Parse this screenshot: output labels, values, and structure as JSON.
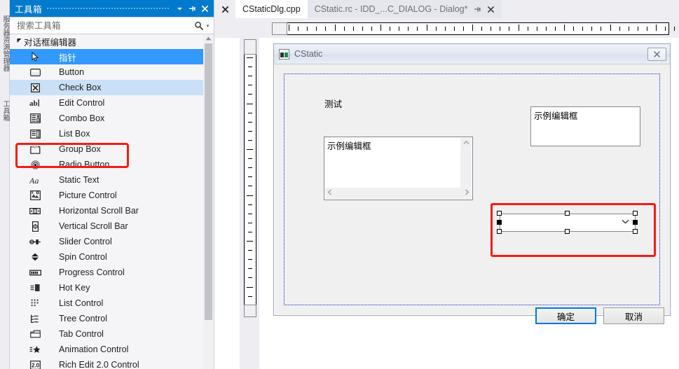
{
  "vertical_tabs": [
    {
      "label": "服务器资源管理器"
    },
    {
      "label": "工具箱"
    }
  ],
  "toolbox": {
    "title": "工具箱",
    "window_buttons": [
      {
        "name": "dropdown",
        "glyph": "▼"
      },
      {
        "name": "auto-hide-pin",
        "glyph": "pin"
      },
      {
        "name": "close",
        "glyph": "✕"
      }
    ],
    "search": {
      "placeholder": "搜索工具箱",
      "icon": "search-icon",
      "caret": "▾"
    },
    "category": {
      "label": "对话框编辑器",
      "expanded": true,
      "arrow": "◢"
    },
    "items": [
      {
        "label": "指针",
        "icon": "pointer-icon",
        "state": "selected"
      },
      {
        "label": "Button",
        "icon": "button-icon",
        "state": "normal"
      },
      {
        "label": "Check Box",
        "icon": "checkbox-icon",
        "state": "hover"
      },
      {
        "label": "Edit Control",
        "icon": "edit-control-icon",
        "state": "normal"
      },
      {
        "label": "Combo Box",
        "icon": "combobox-icon",
        "state": "highlighted"
      },
      {
        "label": "List Box",
        "icon": "listbox-icon",
        "state": "normal"
      },
      {
        "label": "Group Box",
        "icon": "groupbox-icon",
        "state": "normal"
      },
      {
        "label": "Radio Button",
        "icon": "radio-icon",
        "state": "normal"
      },
      {
        "label": "Static Text",
        "icon": "static-text-icon",
        "state": "normal"
      },
      {
        "label": "Picture Control",
        "icon": "picture-icon",
        "state": "normal"
      },
      {
        "label": "Horizontal Scroll Bar",
        "icon": "hscroll-icon",
        "state": "normal"
      },
      {
        "label": "Vertical Scroll Bar",
        "icon": "vscroll-icon",
        "state": "normal"
      },
      {
        "label": "Slider Control",
        "icon": "slider-icon",
        "state": "normal"
      },
      {
        "label": "Spin Control",
        "icon": "spin-icon",
        "state": "normal"
      },
      {
        "label": "Progress Control",
        "icon": "progress-icon",
        "state": "normal"
      },
      {
        "label": "Hot Key",
        "icon": "hotkey-icon",
        "state": "normal"
      },
      {
        "label": "List Control",
        "icon": "list-control-icon",
        "state": "normal"
      },
      {
        "label": "Tree Control",
        "icon": "tree-icon",
        "state": "normal"
      },
      {
        "label": "Tab Control",
        "icon": "tab-icon",
        "state": "normal"
      },
      {
        "label": "Animation Control",
        "icon": "animation-icon",
        "state": "normal"
      },
      {
        "label": "Rich Edit 2.0 Control",
        "icon": "richedit-icon",
        "state": "normal"
      }
    ]
  },
  "editor": {
    "close_all_glyph": "✕",
    "tabs": [
      {
        "label": "CStaticDlg.cpp",
        "active": false,
        "pinned": false,
        "closable": false
      },
      {
        "label": "CStatic.rc - IDD_...C_DIALOG - Dialog*",
        "active": true,
        "pinned": true,
        "closable": true
      }
    ]
  },
  "dialog": {
    "title": "CStatic",
    "close_glyph": "✕",
    "label": "测试",
    "edit_left": "示例编辑框",
    "edit_right": "示例编辑框",
    "combo_value": "",
    "combo_chevron": "⌄",
    "buttons": [
      {
        "label": "确定",
        "focused": true
      },
      {
        "label": "取消",
        "focused": false
      }
    ]
  },
  "colors": {
    "accent": "#007acc",
    "selection": "#3399ff",
    "hover": "#c9e0f7",
    "highlight_red": "#f51c13",
    "button_focus": "#0078d7"
  }
}
